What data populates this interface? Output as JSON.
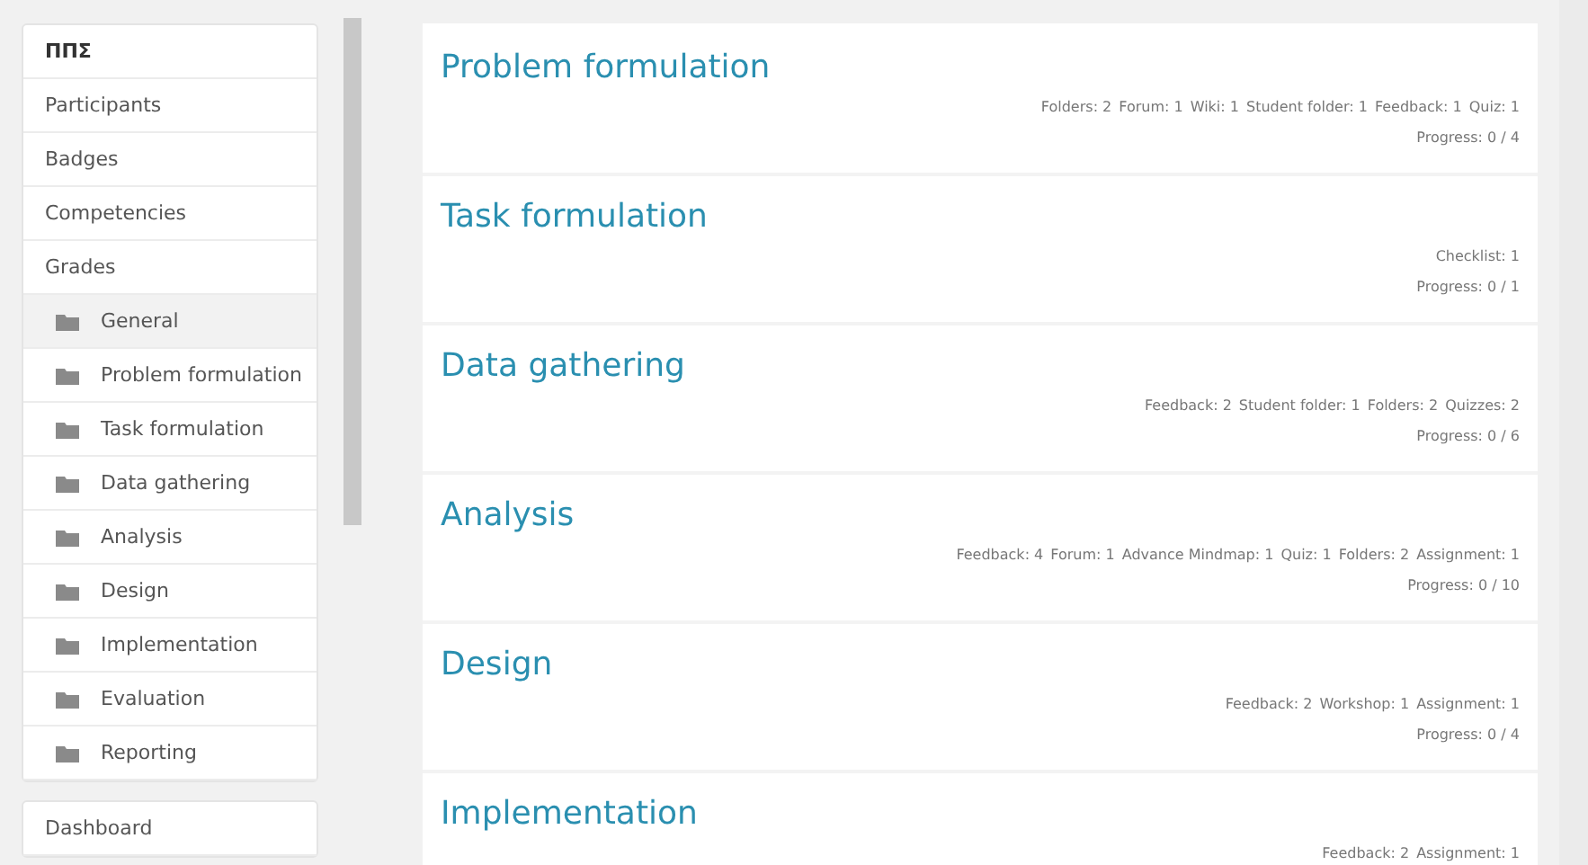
{
  "sidebar": {
    "header": "ΠΠΣ",
    "items": [
      {
        "kind": "link",
        "label": "Participants",
        "selected": false
      },
      {
        "kind": "link",
        "label": "Badges",
        "selected": false
      },
      {
        "kind": "link",
        "label": "Competencies",
        "selected": false
      },
      {
        "kind": "link",
        "label": "Grades",
        "selected": false
      },
      {
        "kind": "section",
        "label": "General",
        "selected": true
      },
      {
        "kind": "section",
        "label": "Problem formulation",
        "selected": false
      },
      {
        "kind": "section",
        "label": "Task formulation",
        "selected": false
      },
      {
        "kind": "section",
        "label": "Data gathering",
        "selected": false
      },
      {
        "kind": "section",
        "label": "Analysis",
        "selected": false
      },
      {
        "kind": "section",
        "label": "Design",
        "selected": false
      },
      {
        "kind": "section",
        "label": "Implementation",
        "selected": false
      },
      {
        "kind": "section",
        "label": "Evaluation",
        "selected": false
      },
      {
        "kind": "section",
        "label": "Reporting",
        "selected": false
      }
    ],
    "footer_items": [
      {
        "label": "Dashboard"
      }
    ]
  },
  "sections": [
    {
      "title": "Problem formulation",
      "activities": [
        "Folders: 2",
        "Forum: 1",
        "Wiki: 1",
        "Student folder: 1",
        "Feedback: 1",
        "Quiz: 1"
      ],
      "progress": "Progress: 0 / 4"
    },
    {
      "title": "Task formulation",
      "activities": [
        "Checklist: 1"
      ],
      "progress": "Progress: 0 / 1"
    },
    {
      "title": "Data gathering",
      "activities": [
        "Feedback: 2",
        "Student folder: 1",
        "Folders: 2",
        "Quizzes: 2"
      ],
      "progress": "Progress: 0 / 6"
    },
    {
      "title": "Analysis",
      "activities": [
        "Feedback: 4",
        "Forum: 1",
        "Advance Mindmap: 1",
        "Quiz: 1",
        "Folders: 2",
        "Assignment: 1"
      ],
      "progress": "Progress: 0 / 10"
    },
    {
      "title": "Design",
      "activities": [
        "Feedback: 2",
        "Workshop: 1",
        "Assignment: 1"
      ],
      "progress": "Progress: 0 / 4"
    },
    {
      "title": "Implementation",
      "activities": [
        "Feedback: 2",
        "Assignment: 1"
      ]
    }
  ]
}
